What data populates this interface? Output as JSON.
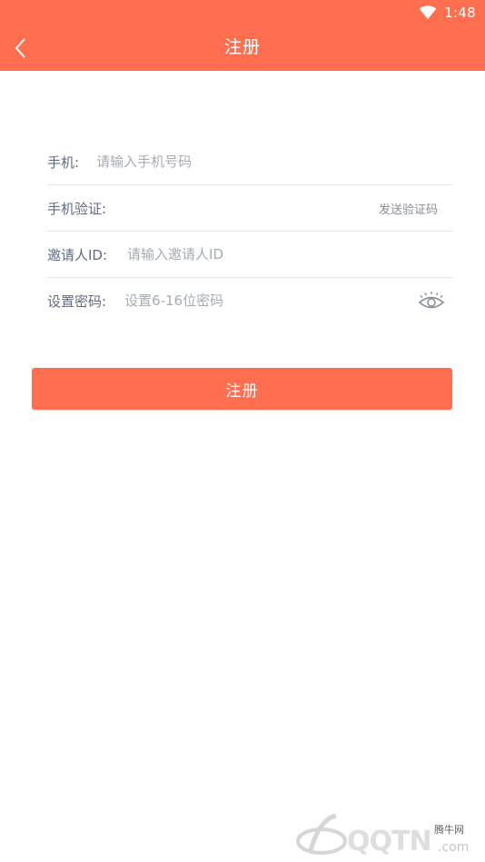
{
  "status_bar": {
    "time": "1:48"
  },
  "app_bar": {
    "title": "注册"
  },
  "form": {
    "phone_label": "手机:",
    "phone_placeholder": "请输入手机号码",
    "code_label": "手机验证:",
    "send_code_label": "发送验证码",
    "inviter_label": "邀请人ID:",
    "inviter_placeholder": "请输入邀请人ID",
    "password_label": "设置密码:",
    "password_placeholder": "设置6-16位密码"
  },
  "register_button": "注册",
  "watermark": {
    "brand": "QQTN",
    "small": "腾牛网",
    "suffix": ".com"
  },
  "colors": {
    "accent": "#FF6E4E",
    "label": "#5f6b80",
    "placeholder": "#a6abb3"
  }
}
